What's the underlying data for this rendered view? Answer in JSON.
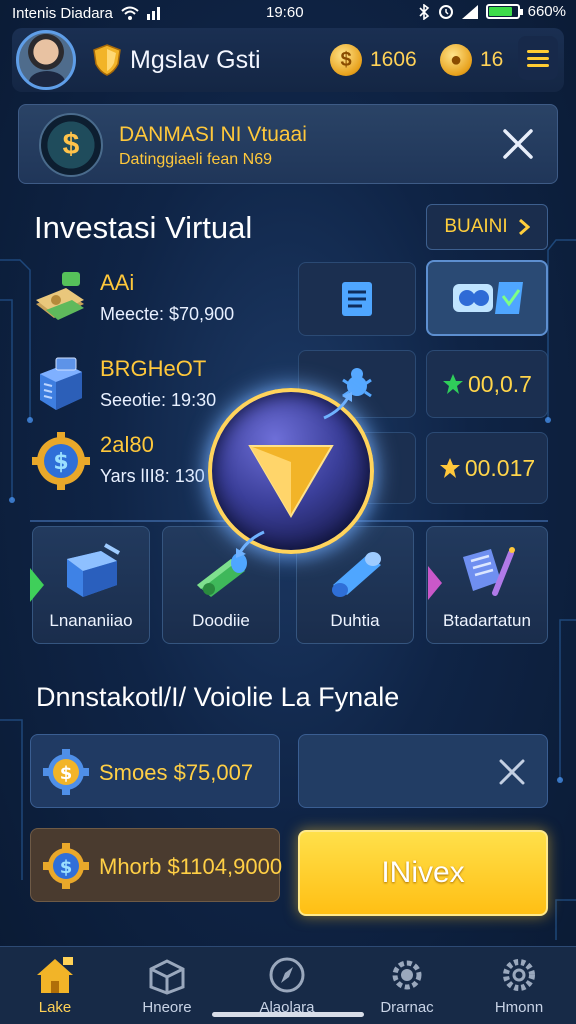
{
  "status_bar": {
    "carrier": "Intenis Diadara",
    "time": "19:60",
    "battery": "660%"
  },
  "header": {
    "username": "Mgslav Gsti",
    "coins": "1606",
    "gems": "16"
  },
  "banner": {
    "title": "DANMASI NI Vtuaai",
    "subtitle": "Datinggiaeli fean N69"
  },
  "investments": {
    "title": "Investasi Virtual",
    "button": "BUAINI",
    "assets": [
      {
        "name": "AAi",
        "detail": "Meecte: $70,900"
      },
      {
        "name": "BRGHeOT",
        "detail": "Seeotie: 19:30"
      },
      {
        "name": "2al80",
        "detail": "Yars lII8: 130"
      }
    ],
    "tile_values": [
      "00,0.7",
      "00.017"
    ]
  },
  "actions": [
    {
      "label": "Lnananiiao"
    },
    {
      "label": "Doodiie"
    },
    {
      "label": "Duhtia"
    },
    {
      "label": "Btadartatun"
    }
  ],
  "section2": {
    "title": "Dnnstakotl/I/ Voiolie La Fynale",
    "panel1": "Smoes $75,007",
    "panel2": "Mhorb $1104,9000",
    "invest_button": "INivex"
  },
  "nav": [
    {
      "label": "Lake",
      "icon": "home-icon"
    },
    {
      "label": "Hneore",
      "icon": "box-icon"
    },
    {
      "label": "Alaolara",
      "icon": "compass-icon"
    },
    {
      "label": "Drarnac",
      "icon": "gear-badge-icon"
    },
    {
      "label": "Hmonn",
      "icon": "settings-icon"
    }
  ],
  "colors": {
    "accent": "#ffc83b",
    "background": "#0f2446",
    "invest_button": "#ffcc22"
  }
}
